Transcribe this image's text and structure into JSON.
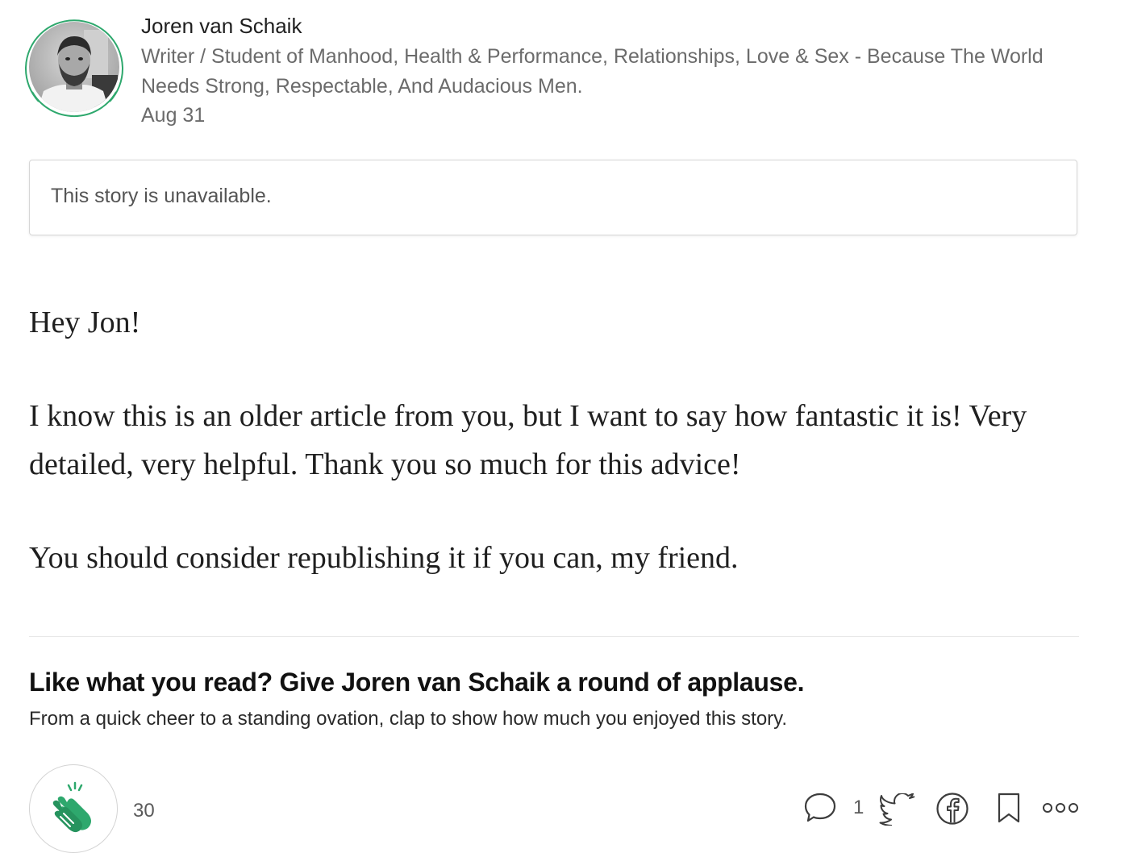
{
  "author": {
    "name": "Joren van Schaik",
    "bio": "Writer / Student of Manhood, Health & Performance, Relationships, Love & Sex - Because The World Needs Strong, Respectable, And Audacious Men.",
    "date": "Aug 31",
    "avatar_ring_color": "#1a8917"
  },
  "unavailable": {
    "text": "This story is unavailable."
  },
  "response": {
    "paragraphs": [
      "Hey Jon!",
      "I know this is an older article from you, but I want to say how fantastic it is! Very detailed, very helpful. Thank you so much for this advice!",
      "You should consider republishing it if you can, my friend."
    ]
  },
  "applause": {
    "heading": "Like what you read? Give Joren van Schaik a round of applause.",
    "subtext": "From a quick cheer to a standing ovation, clap to show how much you enjoyed this story.",
    "clap_count": "30",
    "clap_color": "#2ea86d"
  },
  "actions": {
    "comment_count": "1",
    "icons": [
      "comment-icon",
      "twitter-icon",
      "facebook-icon",
      "bookmark-icon",
      "more-icon"
    ]
  }
}
